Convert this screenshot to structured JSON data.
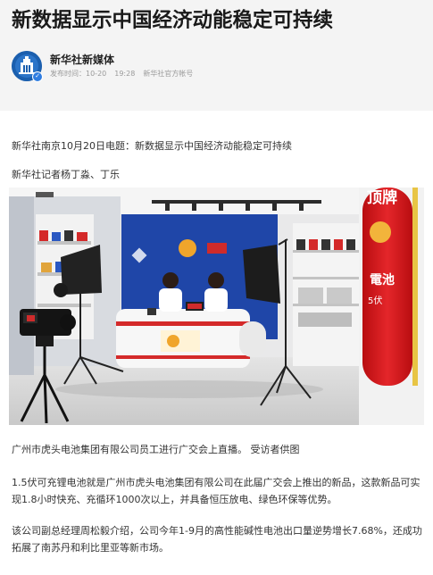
{
  "article": {
    "title": "新数据显示中国经济动能稳定可持续",
    "author": "新华社新媒体",
    "time_label": "发布时间：10-20",
    "time_value": "19:28",
    "account_type": "新华社官方帐号",
    "dateline": "新华社南京10月20日电题：新数据显示中国经济动能稳定可持续",
    "reporters": "新华社记者杨丁淼、丁乐",
    "photo_caption": "广州市虎头电池集团有限公司员工进行广交会上直播。 受访者供图",
    "paragraph_1": "1.5伏可充锂电池就是广州市虎头电池集团有限公司在此届广交会上推出的新品，这款新品可实现1.8小时快充、充循环1000次以上，并具备恒压放电、绿色环保等优势。",
    "paragraph_2": "该公司副总经理周松毅介绍，公司今年1-9月的高性能碱性电池出口量逆势增长7.68%，还成功拓展了南苏丹和利比里亚等新市场。"
  },
  "photo": {
    "banner_text": "顶牌",
    "battery_text": "電池",
    "voltage_text": "5伏"
  },
  "colors": {
    "header_bg": "#f4f4f4",
    "stage_blue": "#1a3f9c",
    "battery_red": "#d7191b"
  },
  "icons": {
    "avatar": "xinhua-logo-icon",
    "verified": "verified-badge-icon"
  }
}
